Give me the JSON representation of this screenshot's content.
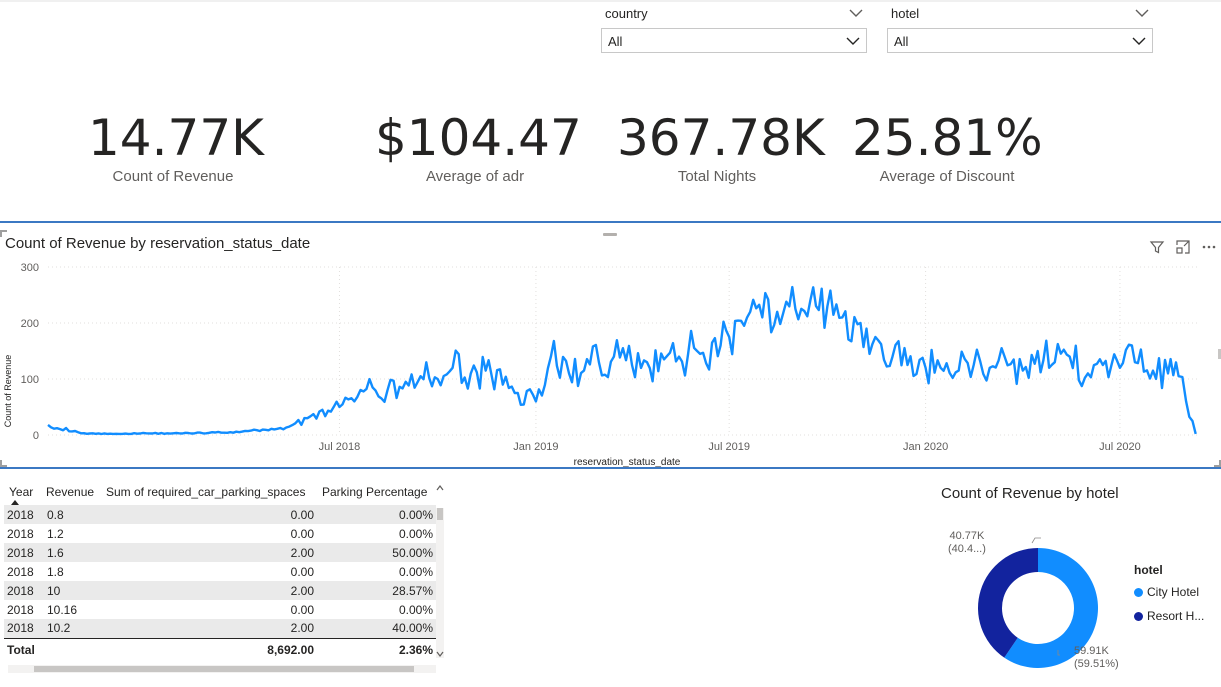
{
  "slicers": [
    {
      "title": "country",
      "value": "All"
    },
    {
      "title": "hotel",
      "value": "All"
    }
  ],
  "kpis": [
    {
      "value": "14.77K",
      "label": "Count of Revenue"
    },
    {
      "value": "$104.47",
      "label": "Average of adr"
    },
    {
      "value": "367.78K",
      "label": "Total Nights"
    },
    {
      "value": "25.81%",
      "label": "Average of Discount"
    }
  ],
  "line_chart": {
    "title": "Count of Revenue by reservation_status_date",
    "icons": [
      "filter-icon",
      "focus-mode-icon",
      "more-options-icon"
    ]
  },
  "table": {
    "columns": [
      "Year",
      "Revenue",
      "Sum of required_car_parking_spaces",
      "Parking Percentage"
    ],
    "rows": [
      [
        "2018",
        "0.8",
        "0.00",
        "0.00%"
      ],
      [
        "2018",
        "1.2",
        "0.00",
        "0.00%"
      ],
      [
        "2018",
        "1.6",
        "2.00",
        "50.00%"
      ],
      [
        "2018",
        "1.8",
        "0.00",
        "0.00%"
      ],
      [
        "2018",
        "10",
        "2.00",
        "28.57%"
      ],
      [
        "2018",
        "10.16",
        "0.00",
        "0.00%"
      ],
      [
        "2018",
        "10.2",
        "2.00",
        "40.00%"
      ]
    ],
    "total": [
      "Total",
      "8,692.00",
      "2.36%"
    ]
  },
  "donut": {
    "title": "Count of Revenue by hotel",
    "legend_title": "hotel",
    "labels": [
      {
        "value": "59.91K",
        "pct": "(59.51%)"
      },
      {
        "value": "40.77K",
        "pct": "(40.4...)"
      }
    ],
    "legend": [
      "City Hotel",
      "Resort H..."
    ]
  },
  "colors": {
    "accent": "#118dff",
    "dark": "#12239e",
    "text": "#252423",
    "muted": "#605e5c"
  },
  "chart_data": [
    {
      "type": "line",
      "title": "Count of Revenue by reservation_status_date",
      "xlabel": "reservation_status_date",
      "ylabel": "Count of Revenue",
      "ylim": [
        0,
        300
      ],
      "yticks": [
        0,
        100,
        200,
        300
      ],
      "xlim": [
        "2017-10-01",
        "2020-09-14"
      ],
      "xticks": [
        {
          "date": "2018-07-01",
          "label": "Jul 2018"
        },
        {
          "date": "2019-01-01",
          "label": "Jan 2019"
        },
        {
          "date": "2019-07-01",
          "label": "Jul 2019"
        },
        {
          "date": "2020-01-01",
          "label": "Jan 2020"
        },
        {
          "date": "2020-07-01",
          "label": "Jul 2020"
        }
      ],
      "grid": true,
      "series": [
        {
          "color": "#118dff",
          "x": [
            "2017-10-01",
            "2017-11-01",
            "2017-12-01",
            "2018-01-01",
            "2018-02-01",
            "2018-03-01",
            "2018-04-01",
            "2018-05-01",
            "2018-05-15",
            "2018-06-01",
            "2018-06-15",
            "2018-07-01",
            "2018-07-15",
            "2018-08-01",
            "2018-08-15",
            "2018-09-01",
            "2018-09-15",
            "2018-10-01",
            "2018-10-15",
            "2018-11-01",
            "2018-11-15",
            "2018-12-01",
            "2018-12-15",
            "2019-01-01",
            "2019-01-15",
            "2019-02-01",
            "2019-02-15",
            "2019-03-01",
            "2019-03-15",
            "2019-04-01",
            "2019-04-15",
            "2019-05-01",
            "2019-05-15",
            "2019-06-01",
            "2019-06-15",
            "2019-07-01",
            "2019-07-15",
            "2019-08-01",
            "2019-08-15",
            "2019-09-01",
            "2019-09-15",
            "2019-10-01",
            "2019-10-15",
            "2019-11-01",
            "2019-11-15",
            "2019-12-01",
            "2019-12-15",
            "2020-01-01",
            "2020-01-15",
            "2020-02-01",
            "2020-02-15",
            "2020-03-01",
            "2020-03-15",
            "2020-04-01",
            "2020-04-15",
            "2020-05-01",
            "2020-05-15",
            "2020-06-01",
            "2020-06-15",
            "2020-07-01",
            "2020-07-15",
            "2020-08-01",
            "2020-08-15",
            "2020-08-25",
            "2020-09-01",
            "2020-09-10"
          ],
          "values": [
            18,
            3,
            2,
            3,
            3,
            4,
            6,
            10,
            15,
            30,
            45,
            50,
            60,
            85,
            80,
            95,
            105,
            100,
            120,
            110,
            115,
            90,
            75,
            60,
            140,
            110,
            115,
            130,
            140,
            125,
            130,
            135,
            140,
            150,
            165,
            175,
            195,
            210,
            220,
            225,
            240,
            230,
            210,
            200,
            175,
            140,
            125,
            120,
            120,
            115,
            125,
            120,
            140,
            115,
            150,
            130,
            140,
            110,
            125,
            120,
            130,
            115,
            110,
            105,
            60,
            2
          ]
        }
      ]
    },
    {
      "type": "pie",
      "title": "Count of Revenue by hotel",
      "legend_title": "hotel",
      "legend_position": "right",
      "categories": [
        "City Hotel",
        "Resort H..."
      ],
      "values": [
        59910,
        40770
      ],
      "percent_labels": [
        "59.51%",
        "40.4..."
      ],
      "colors": [
        "#118dff",
        "#12239e"
      ]
    }
  ]
}
